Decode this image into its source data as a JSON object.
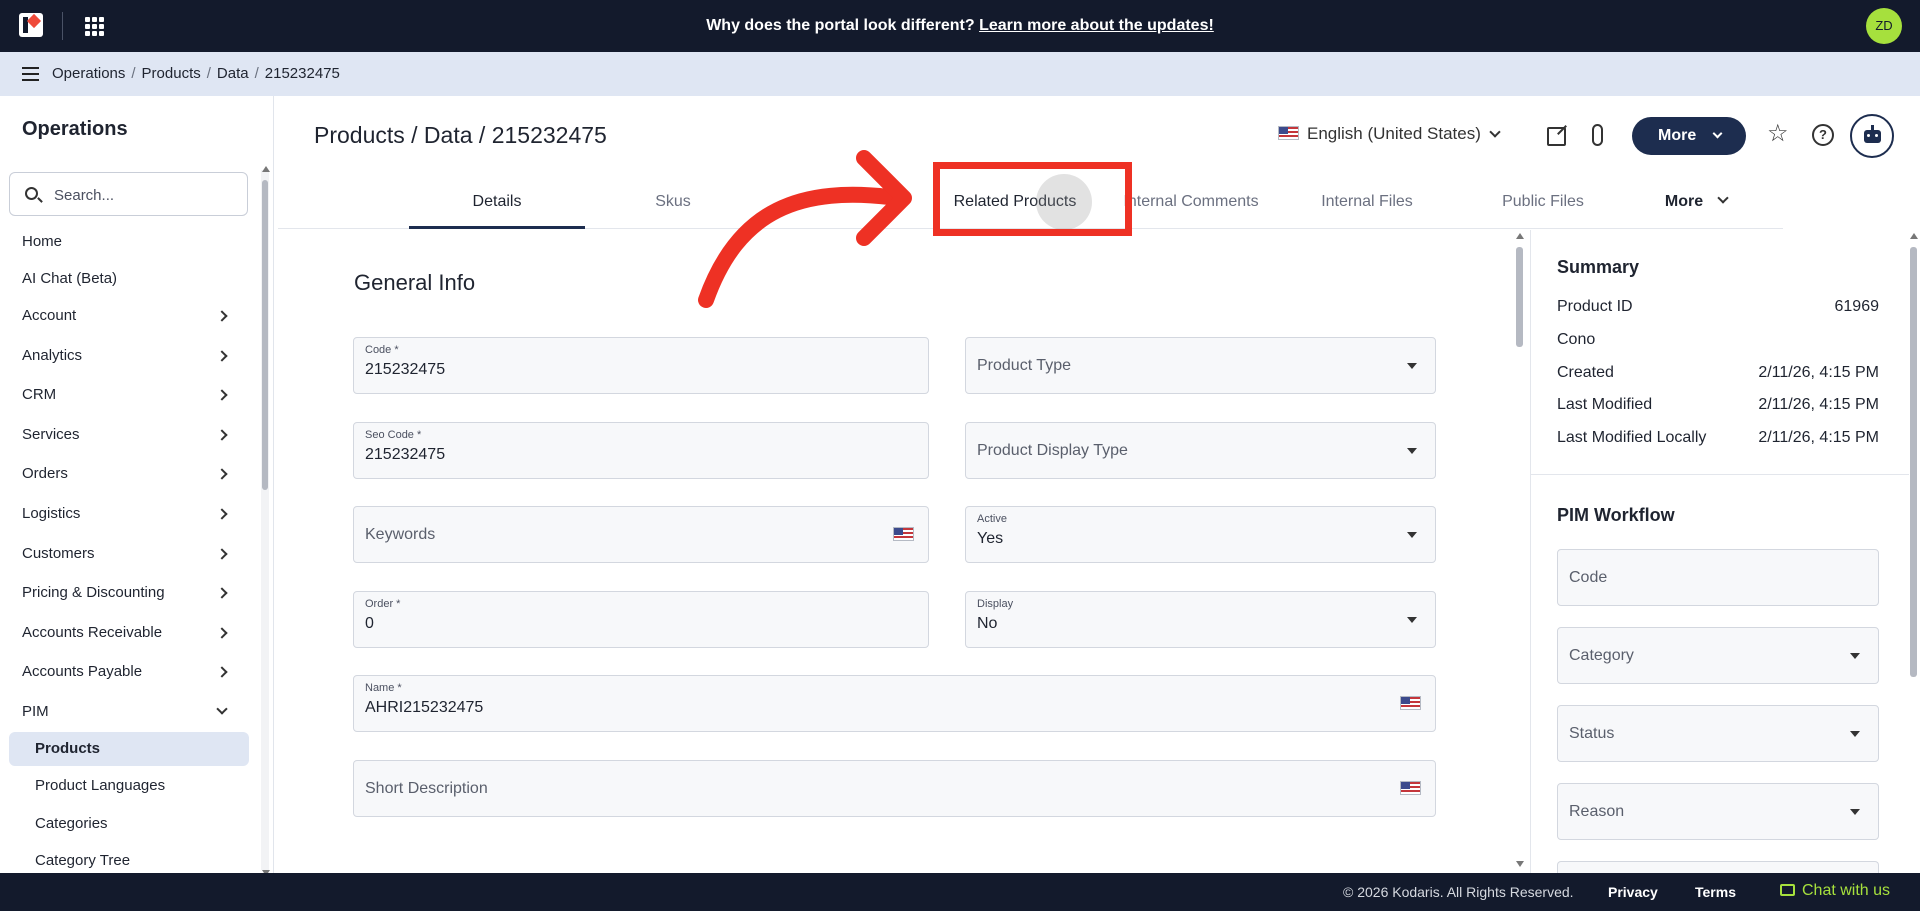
{
  "banner": {
    "text": "Why does the portal look different? ",
    "link": "Learn more about the updates!"
  },
  "user": {
    "initials": "ZD"
  },
  "breadcrumb": [
    "Operations",
    "Products",
    "Data",
    "215232475"
  ],
  "sidebar": {
    "title": "Operations",
    "search_placeholder": "Search...",
    "items": [
      {
        "label": "Home"
      },
      {
        "label": "AI Chat (Beta)"
      },
      {
        "label": "Account"
      },
      {
        "label": "Analytics"
      },
      {
        "label": "CRM"
      },
      {
        "label": "Services"
      },
      {
        "label": "Orders"
      },
      {
        "label": "Logistics"
      },
      {
        "label": "Customers"
      },
      {
        "label": "Pricing & Discounting"
      },
      {
        "label": "Accounts Receivable"
      },
      {
        "label": "Accounts Payable"
      },
      {
        "label": "PIM"
      },
      {
        "label": "Products"
      },
      {
        "label": "Product Languages"
      },
      {
        "label": "Categories"
      },
      {
        "label": "Category Tree"
      }
    ]
  },
  "header": {
    "title": "Products / Data / 215232475",
    "language": "English (United States)",
    "more_label": "More"
  },
  "tabs": [
    {
      "label": "Details"
    },
    {
      "label": "Skus"
    },
    {
      "label": "Related Products"
    },
    {
      "label": "Internal Comments"
    },
    {
      "label": "Internal Files"
    },
    {
      "label": "Public Files"
    },
    {
      "label": "More"
    }
  ],
  "form": {
    "section_title": "General Info",
    "code": {
      "label": "Code *",
      "value": "215232475"
    },
    "product_type": {
      "placeholder": "Product Type"
    },
    "seo_code": {
      "label": "Seo Code *",
      "value": "215232475"
    },
    "product_display_type": {
      "placeholder": "Product Display Type"
    },
    "keywords": {
      "placeholder": "Keywords"
    },
    "active": {
      "label": "Active",
      "value": "Yes"
    },
    "order": {
      "label": "Order *",
      "value": "0"
    },
    "display": {
      "label": "Display",
      "value": "No"
    },
    "name": {
      "label": "Name *",
      "value": "AHRI215232475"
    },
    "short_description": {
      "placeholder": "Short Description"
    }
  },
  "summary": {
    "title": "Summary",
    "rows": [
      {
        "label": "Product ID",
        "value": "61969"
      },
      {
        "label": "Cono",
        "value": ""
      },
      {
        "label": "Created",
        "value": "2/11/26, 4:15 PM"
      },
      {
        "label": "Last Modified",
        "value": "2/11/26, 4:15 PM"
      },
      {
        "label": "Last Modified Locally",
        "value": "2/11/26, 4:15 PM"
      }
    ]
  },
  "workflow": {
    "title": "PIM Workflow",
    "fields": [
      {
        "placeholder": "Code"
      },
      {
        "placeholder": "Category"
      },
      {
        "placeholder": "Status"
      },
      {
        "placeholder": "Reason"
      }
    ]
  },
  "footer": {
    "copyright": "© 2026 Kodaris. All Rights Reserved.",
    "privacy": "Privacy",
    "terms": "Terms",
    "chat": "Chat with us"
  },
  "colors": {
    "navy": "#131a2c",
    "accent": "#1d2d4f",
    "lime": "#a6e03d",
    "annotation_red": "#ee3124"
  }
}
